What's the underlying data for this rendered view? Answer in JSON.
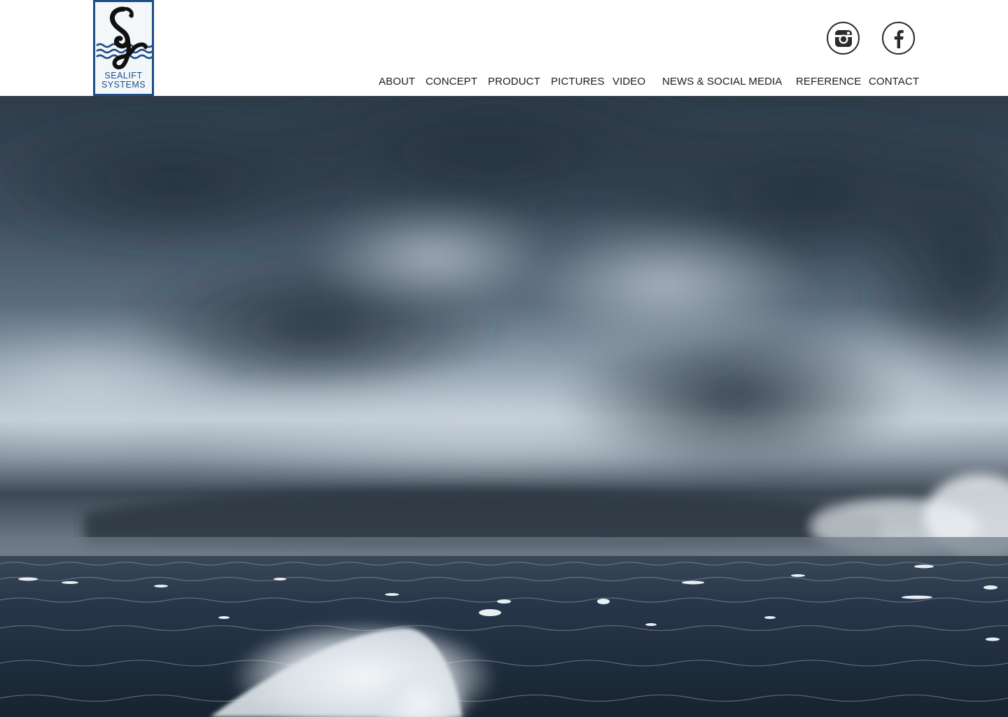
{
  "brand": {
    "line1": "SEALIFT",
    "line2": "SYSTEMS",
    "color": "#1a4e86"
  },
  "social": {
    "instagram_icon": "instagram-icon",
    "facebook_icon": "facebook-icon"
  },
  "nav": {
    "items": [
      {
        "label": "ABOUT"
      },
      {
        "label": "CONCEPT"
      },
      {
        "label": "PRODUCT"
      },
      {
        "label": "PICTURES"
      },
      {
        "label": "VIDEO"
      },
      {
        "label": "NEWS & SOCIAL MEDIA"
      },
      {
        "label": "REFERENCE"
      },
      {
        "label": "CONTACT"
      }
    ]
  },
  "colors": {
    "text": "#1c1c1c",
    "sky_dark": "#3b4a58",
    "sea_dark": "#1c2a38"
  }
}
